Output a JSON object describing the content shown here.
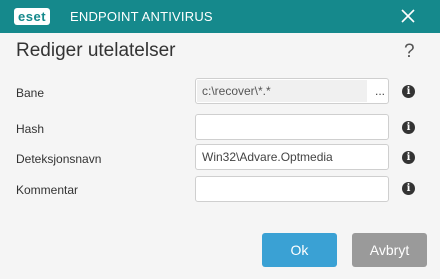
{
  "window": {
    "logo_text": "eset",
    "product_name": "ENDPOINT ANTIVIRUS",
    "close_icon": "close-icon",
    "brand_color": "#15898c"
  },
  "dialog": {
    "title": "Rediger utelatelser",
    "help_icon_text": "?"
  },
  "form": {
    "path": {
      "label": "Bane",
      "value": "c:\\recover\\*.*",
      "browse_label": "..."
    },
    "hash": {
      "label": "Hash",
      "value": ""
    },
    "detection_name": {
      "label": "Deteksjonsnavn",
      "value": "Win32\\Advare.Optmedia"
    },
    "comment": {
      "label": "Kommentar",
      "value": ""
    },
    "info_icon_text": "i"
  },
  "buttons": {
    "ok_label": "Ok",
    "cancel_label": "Avbryt",
    "ok_color": "#3aa1d4",
    "cancel_color": "#9a9a9a"
  }
}
